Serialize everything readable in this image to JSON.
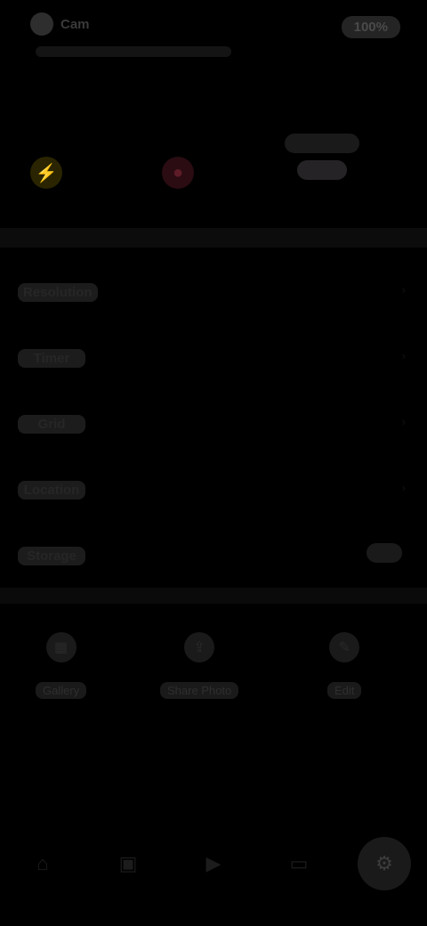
{
  "header": {
    "title": "Cam",
    "battery_label": "100%"
  },
  "quick_toggles": [
    {
      "name": "flash",
      "icon": "bolt-icon",
      "color": "#6b5d10"
    },
    {
      "name": "record",
      "icon": "record-icon",
      "color": "#5e1c28"
    }
  ],
  "settings": {
    "rows": [
      {
        "label": "Resolution"
      },
      {
        "label": "Timer"
      },
      {
        "label": "Grid"
      },
      {
        "label": "Location"
      },
      {
        "label": "Storage"
      }
    ]
  },
  "actions": [
    {
      "label": "Gallery",
      "icon": "gallery-icon"
    },
    {
      "label": "Share Photo",
      "icon": "share-icon"
    },
    {
      "label": "Edit",
      "icon": "edit-icon"
    }
  ],
  "bottom_nav": [
    {
      "icon": "home-icon",
      "glyph": "⌂"
    },
    {
      "icon": "photo-icon",
      "glyph": "▣"
    },
    {
      "icon": "video-icon",
      "glyph": "▶"
    },
    {
      "icon": "folder-icon",
      "glyph": "▭"
    },
    {
      "icon": "settings-icon",
      "glyph": "⚙",
      "active": true
    }
  ]
}
